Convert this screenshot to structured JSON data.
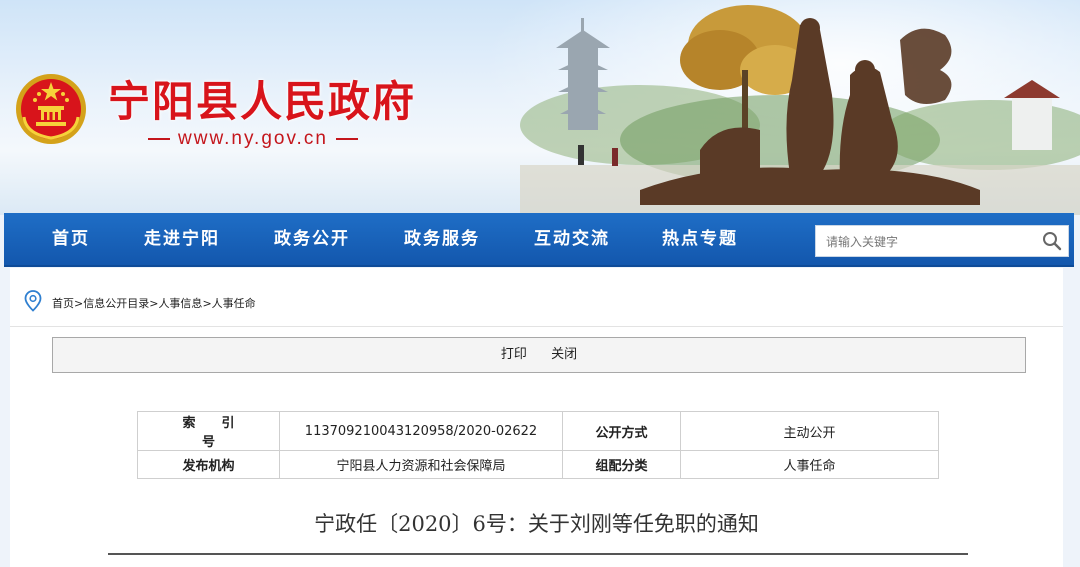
{
  "header": {
    "site_title": "宁阳县人民政府",
    "site_url": "www.ny.gov.cn",
    "emblem_icon": "national-emblem-icon",
    "brand_color": "#d8141b"
  },
  "nav": {
    "items": [
      {
        "label": "首页"
      },
      {
        "label": "走进宁阳"
      },
      {
        "label": "政务公开"
      },
      {
        "label": "政务服务"
      },
      {
        "label": "互动交流"
      },
      {
        "label": "热点专题"
      }
    ],
    "search": {
      "placeholder": "请输入关键字",
      "icon": "search-icon"
    },
    "bar_color": "#1862b8"
  },
  "breadcrumb": {
    "icon": "location-pin-icon",
    "items": [
      "首页",
      "信息公开目录",
      "人事信息",
      "人事任命"
    ],
    "separator": ">"
  },
  "toolbar": {
    "print_label": "打印",
    "close_label": "关闭"
  },
  "meta": {
    "index_label": "索引号",
    "index_value": "113709210043120958/2020-02622",
    "open_mode_label": "公开方式",
    "open_mode_value": "主动公开",
    "publisher_label": "发布机构",
    "publisher_value": "宁阳县人力资源和社会保障局",
    "category_label": "组配分类",
    "category_value": "人事任命"
  },
  "document": {
    "title": "宁政任〔2020〕6号：关于刘刚等任免职的通知"
  }
}
